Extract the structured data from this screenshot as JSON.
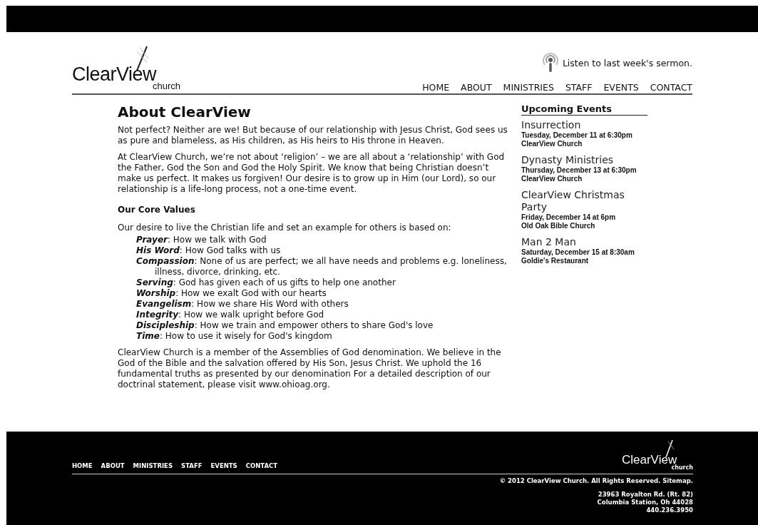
{
  "header": {
    "logo": {
      "name": "ClearView",
      "sub": "church"
    },
    "sermon_link": "Listen to last week's sermon.",
    "nav": [
      "HOME",
      "ABOUT",
      "MINISTRIES",
      "STAFF",
      "EVENTS",
      "CONTACT"
    ]
  },
  "main": {
    "title": "About ClearView",
    "intro": [
      "Not perfect? Neither are we! But because of our relationship with Jesus Christ, God sees us as pure and blameless, as His children, as His heirs to His throne in Heaven.",
      "At ClearView Church, we’re not about ‘religion’ – we are all about a ‘relationship’ with God the Father, God the Son and God the Holy Spirit. We know that being Christian doesn’t make us perfect. It makes us forgiven! Our desire is to grow up in Him (our Lord), so our relationship is a life-long process, not a one-time event."
    ],
    "values_heading": "Our Core Values",
    "values_intro": "Our desire to live the Christian life and set an example for others is based on:",
    "values": [
      {
        "term": "Prayer",
        "text": ": How we talk with God"
      },
      {
        "term": "His Word",
        "text": ": How God talks with us"
      },
      {
        "term": "Compassion",
        "text": ": None of us are perfect; we all have needs and problems e.g. loneliness, illness, divorce, drinking, etc."
      },
      {
        "term": "Serving",
        "text": ": God has given each of us gifts to help one another"
      },
      {
        "term": "Worship",
        "text": ": How we exalt God with our hearts"
      },
      {
        "term": "Evangelism",
        "text": ": How we share His Word with others"
      },
      {
        "term": "Integrity",
        "text": ": How we walk upright before God"
      },
      {
        "term": "Discipleship",
        "text": ": How we train and empower others to share God's love"
      },
      {
        "term": "Time",
        "text": ": How to use it wisely for God's kingdom"
      }
    ],
    "closing": "ClearView Church is a member of the Assemblies of God denomination. We believe in the God of the Bible and the salvation offered by His Son, Jesus Christ. We uphold the 16 fundamental truths as presented by our denomination For a detailed description of our doctrinal statement, please visit www.ohioag.org."
  },
  "sidebar": {
    "heading": "Upcoming Events",
    "events": [
      {
        "title": "Insurrection",
        "date": "Tuesday, December 11 at 6:30pm",
        "place": "ClearView Church"
      },
      {
        "title": "Dynasty Ministries",
        "date": "Thursday, December 13 at 6:30pm",
        "place": "ClearView Church"
      },
      {
        "title": "ClearView Christmas Party",
        "date": "Friday, December 14 at 6pm",
        "place": "Old Oak Bible Church"
      },
      {
        "title": "Man 2 Man",
        "date": "Saturday, December 15 at 8:30am",
        "place": "Goldie's Restaurant"
      }
    ]
  },
  "footer": {
    "nav": [
      "HOME",
      "ABOUT",
      "MINISTRIES",
      "STAFF",
      "EVENTS",
      "CONTACT"
    ],
    "logo": {
      "name": "ClearView",
      "sub": "church"
    },
    "copyright": "© 2012 ClearView Church. All Rights Reserved. Sitemap.",
    "address": [
      "23963 Royalton Rd. (Rt. 82)",
      "Columbia Station, Oh 44028",
      "440.236.3950"
    ]
  }
}
